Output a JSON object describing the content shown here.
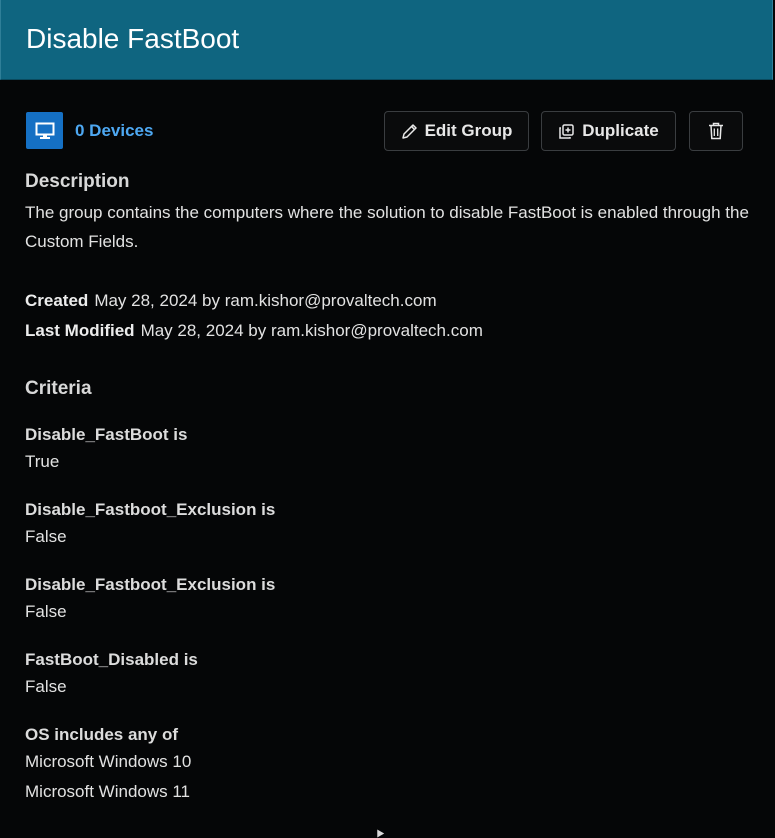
{
  "header": {
    "title": "Disable FastBoot"
  },
  "devices": {
    "label": "0 Devices",
    "icon": "monitor-icon",
    "icon_bg": "#1570c4",
    "link_color": "#4ea8f2"
  },
  "toolbar": {
    "edit_label": "Edit Group",
    "duplicate_label": "Duplicate",
    "delete_icon": "trash-icon"
  },
  "description": {
    "heading": "Description",
    "text": "The group contains the computers where the solution to disable FastBoot is enabled through the Custom Fields."
  },
  "meta": {
    "created_label": "Created",
    "created_value": "May 28, 2024 by ram.kishor@provaltech.com",
    "modified_label": "Last Modified",
    "modified_value": "May 28, 2024 by ram.kishor@provaltech.com"
  },
  "criteria": {
    "heading": "Criteria",
    "items": [
      {
        "label": "Disable_FastBoot is",
        "values": [
          "True"
        ]
      },
      {
        "label": "Disable_Fastboot_Exclusion is",
        "values": [
          "False"
        ]
      },
      {
        "label": "Disable_Fastboot_Exclusion is",
        "values": [
          "False"
        ]
      },
      {
        "label": "FastBoot_Disabled is",
        "values": [
          "False"
        ]
      },
      {
        "label": "OS includes any of",
        "values": [
          "Microsoft Windows 10",
          "Microsoft Windows 11"
        ]
      }
    ]
  },
  "colors": {
    "header_bg": "#0f6580",
    "page_bg": "#050607"
  }
}
